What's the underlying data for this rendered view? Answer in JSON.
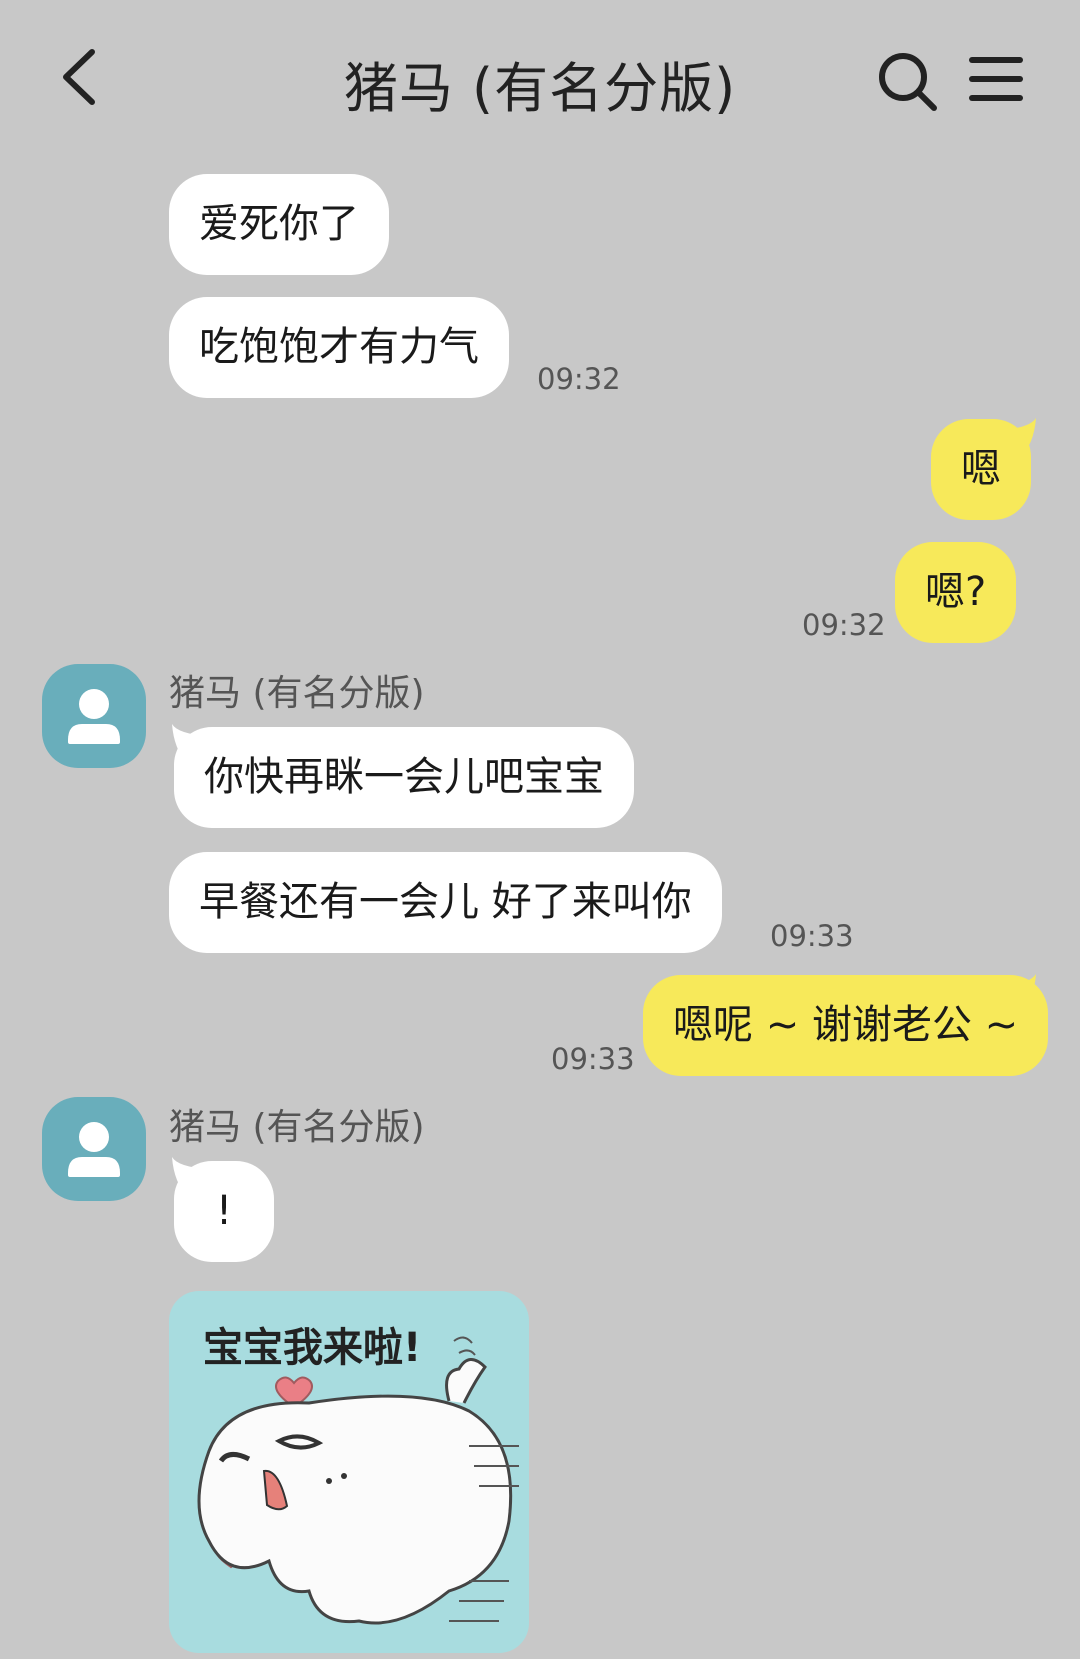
{
  "header": {
    "title": "猪马 (有名分版)"
  },
  "messages": [
    {
      "text": "爱死你了"
    },
    {
      "text": "吃饱饱才有力气",
      "time": "09:32"
    },
    {
      "text": "嗯"
    },
    {
      "text": "嗯?",
      "time": "09:32"
    },
    {
      "sender": "猪马 (有名分版)",
      "text": "你快再眯一会儿吧宝宝"
    },
    {
      "text": "早餐还有一会儿  好了来叫你",
      "time": "09:33"
    },
    {
      "text": "嗯呢 ~ 谢谢老公 ~",
      "time": "09:33"
    },
    {
      "sender": "猪马 (有名分版)",
      "text": "!"
    },
    {
      "sticker_caption": "宝宝我来啦!"
    }
  ]
}
